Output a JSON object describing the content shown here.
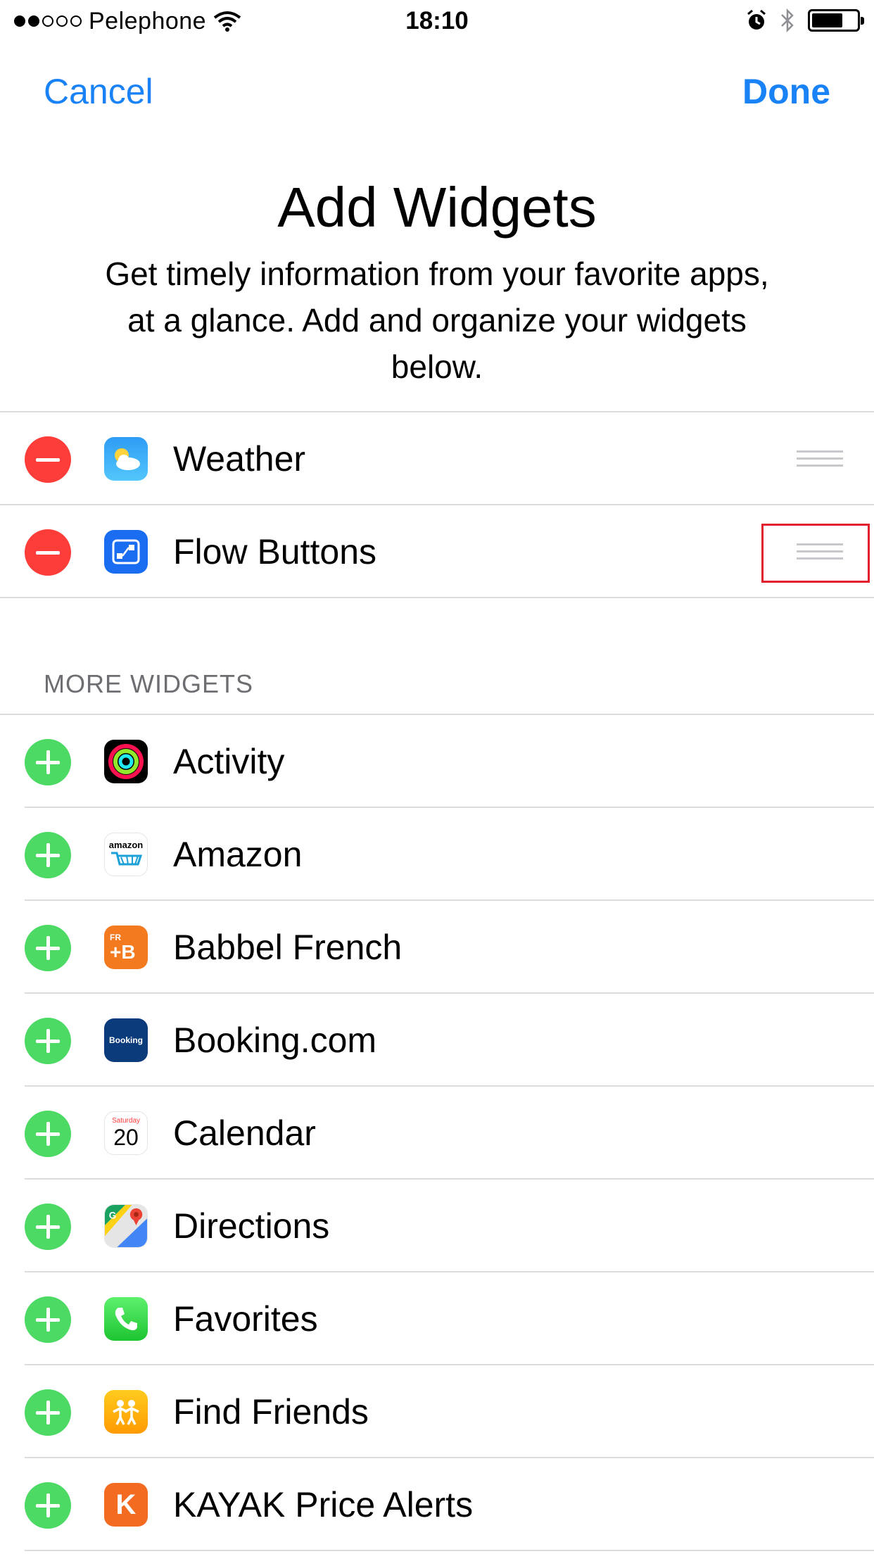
{
  "status_bar": {
    "carrier": "Pelephone",
    "time": "18:10",
    "battery_level": 0.7
  },
  "nav": {
    "cancel_label": "Cancel",
    "done_label": "Done"
  },
  "header": {
    "title": "Add Widgets",
    "subtitle": "Get timely information from your favorite apps, at a glance. Add and organize your widgets below."
  },
  "active_widgets": [
    {
      "label": "Weather",
      "icon": "weather-icon"
    },
    {
      "label": "Flow Buttons",
      "icon": "flow-buttons-icon"
    }
  ],
  "more_widgets": {
    "header": "MORE WIDGETS",
    "items": [
      {
        "label": "Activity",
        "icon": "activity-icon"
      },
      {
        "label": "Amazon",
        "icon": "amazon-icon",
        "icon_text": "amazon"
      },
      {
        "label": "Babbel French",
        "icon": "babbel-icon",
        "icon_text": "FR",
        "icon_text2": "+B"
      },
      {
        "label": "Booking.com",
        "icon": "booking-icon",
        "icon_text": "Booking"
      },
      {
        "label": "Calendar",
        "icon": "calendar-icon",
        "icon_text": "Saturday",
        "icon_text2": "20"
      },
      {
        "label": "Directions",
        "icon": "directions-icon"
      },
      {
        "label": "Favorites",
        "icon": "phone-icon"
      },
      {
        "label": "Find Friends",
        "icon": "find-friends-icon"
      },
      {
        "label": "KAYAK Price Alerts",
        "icon": "kayak-icon",
        "icon_text": "K"
      }
    ]
  },
  "colors": {
    "accent": "#1a82f7",
    "remove": "#fc3d39",
    "add": "#4cd964",
    "highlight": "#e0202a"
  }
}
